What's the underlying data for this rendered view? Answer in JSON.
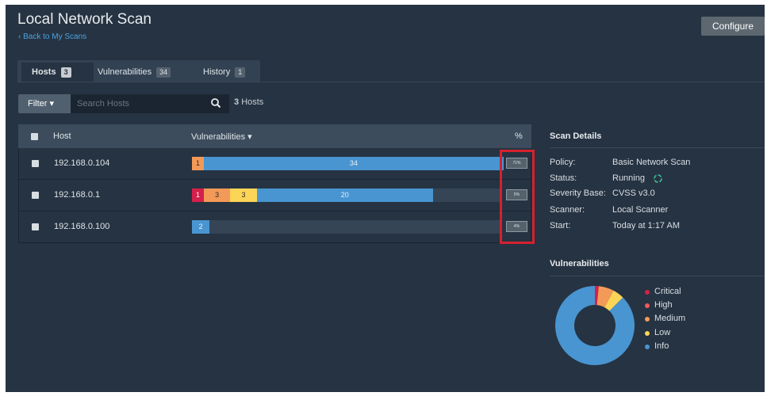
{
  "header": {
    "title": "Local Network Scan",
    "back_link": "‹ Back to My Scans",
    "configure_label": "Configure"
  },
  "tabs": [
    {
      "label": "Hosts",
      "count": "3"
    },
    {
      "label": "Vulnerabilities",
      "count": "34"
    },
    {
      "label": "History",
      "count": "1"
    }
  ],
  "toolbar": {
    "filter_label": "Filter ▾",
    "search_placeholder": "Search Hosts",
    "host_count_num": "3",
    "host_count_label": "Hosts"
  },
  "table": {
    "headers": {
      "host": "Host",
      "vulnerabilities": "Vulnerabilities ▾",
      "percent": "%"
    },
    "rows": [
      {
        "host": "192.168.0.104",
        "percent": "71%",
        "segments": [
          {
            "severity": "medium",
            "label": "1",
            "value": 1
          },
          {
            "severity": "info",
            "label": "34",
            "value": 34
          }
        ]
      },
      {
        "host": "192.168.0.1",
        "percent": "5%",
        "segments": [
          {
            "severity": "critical",
            "label": "1",
            "value": 1
          },
          {
            "severity": "medium",
            "label": "3",
            "value": 3
          },
          {
            "severity": "low",
            "label": "3",
            "value": 3
          },
          {
            "severity": "info",
            "label": "20",
            "value": 20
          }
        ]
      },
      {
        "host": "192.168.0.100",
        "percent": "4%",
        "segments": [
          {
            "severity": "info",
            "label": "2",
            "value": 2
          }
        ]
      }
    ]
  },
  "scan_details": {
    "title": "Scan Details",
    "policy_label": "Policy:",
    "policy_value": "Basic Network Scan",
    "status_label": "Status:",
    "status_value": "Running",
    "severity_label": "Severity Base:",
    "severity_value": "CVSS v3.0",
    "scanner_label": "Scanner:",
    "scanner_value": "Local Scanner",
    "start_label": "Start:",
    "start_value": "Today at 1:17 AM"
  },
  "vulnerabilities_chart": {
    "title": "Vulnerabilities",
    "legend": [
      "Critical",
      "High",
      "Medium",
      "Low",
      "Info"
    ]
  },
  "colors": {
    "critical": "#d4204a",
    "high": "#ee5a5a",
    "medium": "#f39a58",
    "low": "#fcd557",
    "info": "#4895d1",
    "accent": "#4aa3df",
    "highlight": "#d6202d"
  }
}
